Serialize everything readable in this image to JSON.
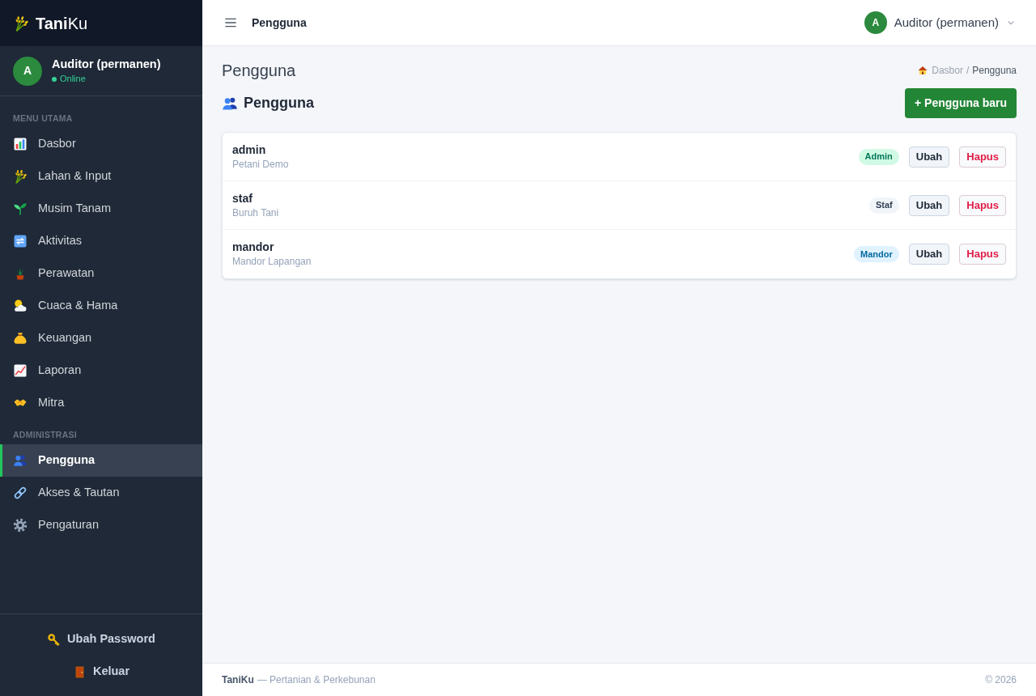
{
  "sidebar": {
    "brand": "**Tani**Ku",
    "user": {
      "avatar": "A",
      "name": "Auditor (permanen)",
      "status": "Online"
    },
    "sections": [
      {
        "title": "MENU UTAMA",
        "items": [
          {
            "label": "Dasbor",
            "selected": false
          },
          {
            "label": "Lahan & Input",
            "selected": false
          },
          {
            "label": "Musim Tanam",
            "selected": false
          },
          {
            "label": "Aktivitas",
            "selected": false
          },
          {
            "label": "Perawatan",
            "selected": false
          },
          {
            "label": "Cuaca & Hama",
            "selected": false
          },
          {
            "label": "Keuangan",
            "selected": false
          },
          {
            "label": "Laporan",
            "selected": false
          },
          {
            "label": "Mitra",
            "selected": false
          }
        ]
      },
      {
        "title": "ADMINISTRASI",
        "items": [
          {
            "label": "Pengguna",
            "selected": true
          },
          {
            "label": "Akses & Tautan",
            "selected": false
          },
          {
            "label": "Pengaturan",
            "selected": false
          }
        ]
      }
    ],
    "footer_actions": [
      "Ubah Password",
      "Keluar"
    ]
  },
  "topbar": {
    "title": "Pengguna",
    "user": {
      "avatar": "A",
      "name": "Auditor (permanen)"
    }
  },
  "page": {
    "title": "Pengguna",
    "breadcrumb": {
      "items": [
        "Dasbor",
        "Pengguna"
      ],
      "separator": "/"
    },
    "section_title": "Pengguna",
    "new_button": "+ Pengguna baru"
  },
  "users": [
    {
      "username": "admin",
      "full_name": "Petani Demo",
      "role": {
        "label": "Admin",
        "kind": "admin"
      },
      "actions": [
        {
          "label": "Ubah",
          "kind": "edit"
        },
        {
          "label": "Hapus",
          "kind": "delete"
        }
      ]
    },
    {
      "username": "staf",
      "full_name": "Buruh Tani",
      "role": {
        "label": "Staf",
        "kind": "staff"
      },
      "actions": [
        {
          "label": "Ubah",
          "kind": "edit"
        },
        {
          "label": "Hapus",
          "kind": "delete"
        }
      ]
    },
    {
      "username": "mandor",
      "full_name": "Mandor Lapangan",
      "role": {
        "label": "Mandor",
        "kind": "foreman"
      },
      "actions": [
        {
          "label": "Ubah",
          "kind": "edit"
        },
        {
          "label": "Hapus",
          "kind": "delete"
        }
      ]
    }
  ],
  "footer": {
    "brand": "TaniKu",
    "tagline": "— Pertanian & Perkebunan",
    "copyright": "© 2026"
  }
}
